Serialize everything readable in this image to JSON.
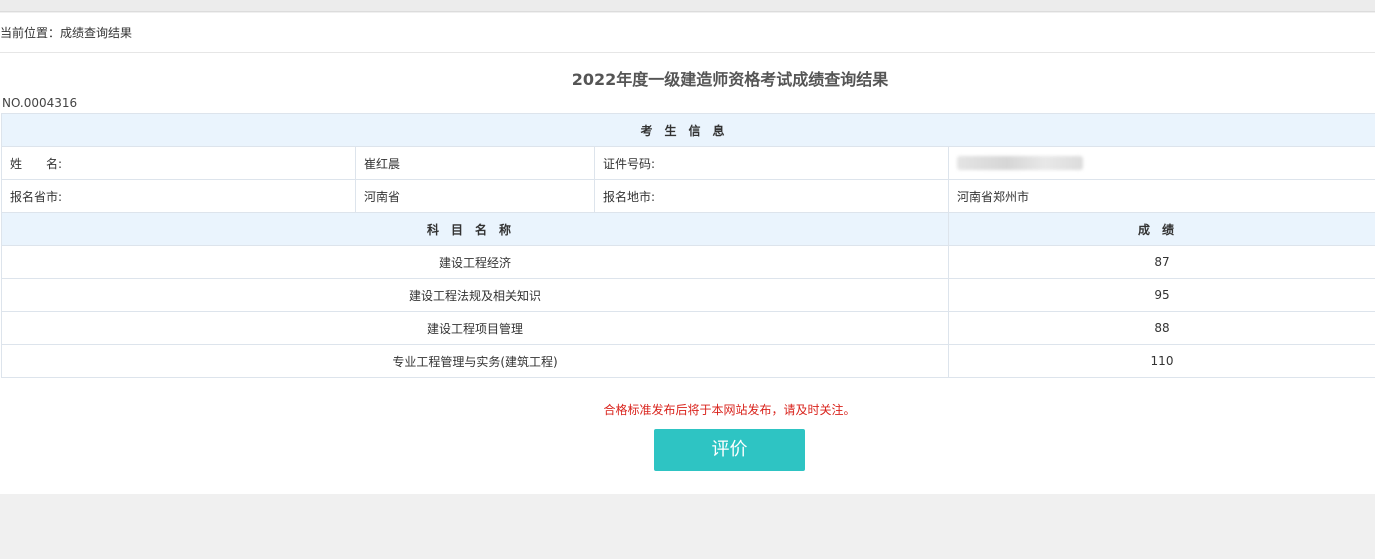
{
  "breadcrumb": {
    "text": "当前位置：成绩查询结果"
  },
  "title": "2022年度一级建造师资格考试成绩查询结果",
  "record_no": "NO.0004316",
  "candidate_section": {
    "header": "考生信息",
    "name_label": "姓　　名:",
    "name_value": "崔红晨",
    "id_label": "证件号码:",
    "id_value_redacted": true,
    "province_label": "报名省市:",
    "province_value": "河南省",
    "city_label": "报名地市:",
    "city_value": "河南省郑州市"
  },
  "scores": {
    "subject_header": "科目名称",
    "score_header": "成绩",
    "rows": [
      {
        "subject": "建设工程经济",
        "score": "87"
      },
      {
        "subject": "建设工程法规及相关知识",
        "score": "95"
      },
      {
        "subject": "建设工程项目管理",
        "score": "88"
      },
      {
        "subject": "专业工程管理与实务(建筑工程)",
        "score": "110"
      }
    ]
  },
  "notice": "合格标准发布后将于本网站发布，请及时关注。",
  "rate_button_label": "评价",
  "colors": {
    "header_bg": "#eaf4fd",
    "notice": "#d9231c",
    "button": "#2ec4c3"
  }
}
